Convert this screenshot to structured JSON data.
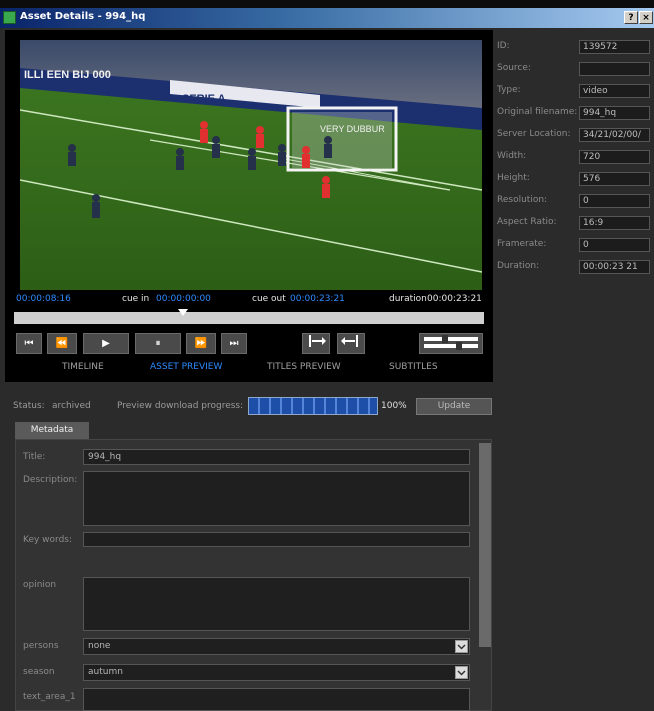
{
  "window": {
    "title": "Asset Details - 994_hq",
    "help_label": "?",
    "close_label": "×"
  },
  "player": {
    "current_time": "00:00:08:16",
    "cue_in_label": "cue in",
    "cue_in": "00:00:00:00",
    "cue_out_label": "cue out",
    "cue_out": "00:00:23:21",
    "duration_label": "duration",
    "duration": "00:00:23:21",
    "scrub_position": 0.36,
    "controls": [
      "⏮",
      "⏪",
      "▶",
      "⏸",
      "⏩",
      "⏭"
    ],
    "tabs": [
      "TIMELINE",
      "ASSET PREVIEW",
      "TITLES PREVIEW",
      "SUBTITLES"
    ],
    "active_tab": "ASSET PREVIEW",
    "video": {
      "banner_text": "SERIE A",
      "board_text": "VERY DUBBUR",
      "ad_text": "ILLI EEN BIJ 000"
    }
  },
  "properties": [
    {
      "label": "ID:",
      "value": "139572"
    },
    {
      "label": "Source:",
      "value": ""
    },
    {
      "label": "Type:",
      "value": "video"
    },
    {
      "label": "Original filename:",
      "value": "994_hq"
    },
    {
      "label": "Server Location:",
      "value": "34/21/02/00/"
    },
    {
      "label": "Width:",
      "value": "720"
    },
    {
      "label": "Height:",
      "value": "576"
    },
    {
      "label": "Resolution:",
      "value": "0"
    },
    {
      "label": "Aspect Ratio:",
      "value": "16:9"
    },
    {
      "label": "Framerate:",
      "value": "0"
    },
    {
      "label": "Duration:",
      "value": "00:00:23 21"
    }
  ],
  "status": {
    "label": "Status:",
    "value": "archived",
    "progress_label": "Preview download progress:",
    "progress_pct_text": "100%",
    "progress": 1.0,
    "update_label": "Update"
  },
  "metadata": {
    "tab_label": "Metadata",
    "fields": {
      "title_label": "Title:",
      "title_value": "994_hq",
      "description_label": "Description:",
      "description_value": "",
      "keywords_label": "Key words:",
      "keywords_value": "",
      "opinion_label": "opinion",
      "opinion_value": "",
      "persons_label": "persons",
      "persons_value": "none",
      "season_label": "season",
      "season_value": "autumn",
      "text_area_label": "text_area_1",
      "text_area_value": ""
    }
  },
  "colors": {
    "accent": "#2e8bff",
    "title_bar": "#0a246a",
    "panel": "#2b2b2b"
  }
}
